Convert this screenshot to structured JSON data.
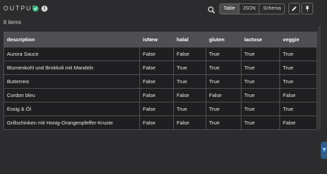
{
  "header": {
    "title": "OUTPUT",
    "status_icon": "check-circle-icon",
    "info_icon": "info-icon",
    "view_tabs": [
      {
        "label": "Table",
        "active": true
      },
      {
        "label": "JSON",
        "active": false
      },
      {
        "label": "Schema",
        "active": false
      }
    ],
    "edit_icon": "pencil-icon",
    "pin_icon": "pin-icon"
  },
  "summary": {
    "count_text": "6 items"
  },
  "table": {
    "columns": [
      "description",
      "isNew",
      "halal",
      "gluten",
      "lactose",
      "veggie"
    ],
    "rows": [
      [
        "Aurora Sauce",
        "False",
        "False",
        "True",
        "True",
        "True"
      ],
      [
        "Blumenkohl und Brokkoli mit Mandeln",
        "False",
        "True",
        "True",
        "True",
        "True"
      ],
      [
        "Butterreis",
        "False",
        "True",
        "True",
        "True",
        "True"
      ],
      [
        "Cordon bleu",
        "False",
        "False",
        "False",
        "True",
        "False"
      ],
      [
        "Essig & Öl",
        "False",
        "True",
        "True",
        "True",
        "True"
      ],
      [
        "Grillschinken mit Honig-Orangenpfeffer-Kruste",
        "False",
        "False",
        "True",
        "True",
        "False"
      ]
    ]
  },
  "colors": {
    "accent_green": "#36b37e",
    "handle_blue": "#2f5f88"
  }
}
